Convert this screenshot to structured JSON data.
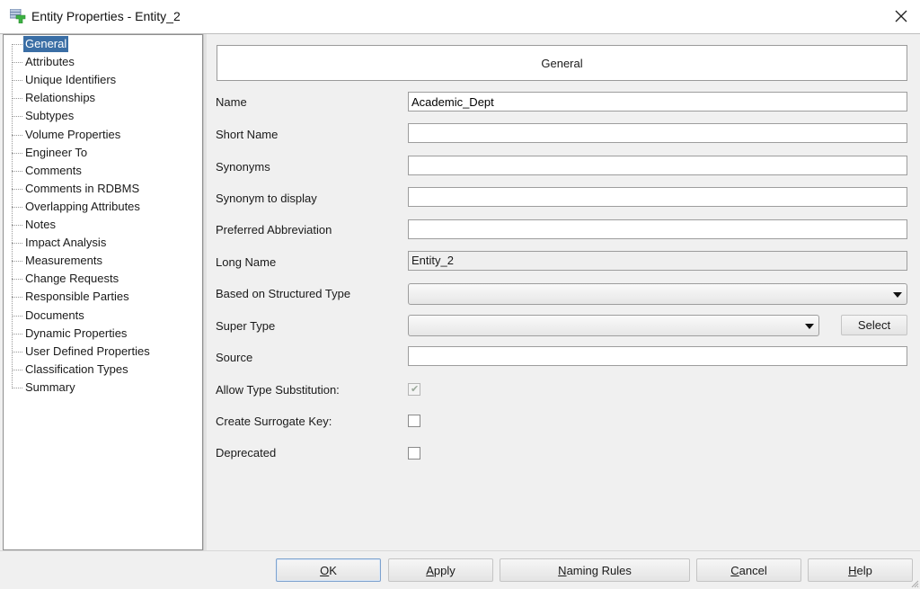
{
  "window": {
    "title": "Entity Properties - Entity_2",
    "app_icon": "entity-table-icon",
    "close_icon": "close-icon"
  },
  "tree": {
    "selected": "General",
    "items": [
      {
        "label": "General"
      },
      {
        "label": "Attributes"
      },
      {
        "label": "Unique Identifiers"
      },
      {
        "label": "Relationships"
      },
      {
        "label": "Subtypes"
      },
      {
        "label": "Volume Properties"
      },
      {
        "label": "Engineer To"
      },
      {
        "label": "Comments"
      },
      {
        "label": "Comments in RDBMS"
      },
      {
        "label": "Overlapping Attributes"
      },
      {
        "label": "Notes"
      },
      {
        "label": "Impact Analysis"
      },
      {
        "label": "Measurements"
      },
      {
        "label": "Change Requests"
      },
      {
        "label": "Responsible Parties"
      },
      {
        "label": "Documents"
      },
      {
        "label": "Dynamic Properties"
      },
      {
        "label": "User Defined Properties"
      },
      {
        "label": "Classification Types"
      },
      {
        "label": "Summary"
      }
    ]
  },
  "panel": {
    "header": "General",
    "fields": {
      "name": {
        "label": "Name",
        "value": "Academic_Dept"
      },
      "short_name": {
        "label": "Short Name",
        "value": ""
      },
      "synonyms": {
        "label": "Synonyms",
        "value": ""
      },
      "synonym_display": {
        "label": "Synonym to display",
        "value": ""
      },
      "preferred_abbreviation": {
        "label": "Preferred Abbreviation",
        "value": ""
      },
      "long_name": {
        "label": "Long Name",
        "value": "Entity_2"
      },
      "based_on_structured_type": {
        "label": "Based on Structured Type",
        "value": ""
      },
      "super_type": {
        "label": "Super Type",
        "value": "",
        "select_label": "Select"
      },
      "source": {
        "label": "Source",
        "value": ""
      },
      "allow_type_substitution": {
        "label": "Allow Type Substitution:",
        "checked": true,
        "disabled": true
      },
      "create_surrogate_key": {
        "label": "Create Surrogate Key:",
        "checked": false
      },
      "deprecated": {
        "label": "Deprecated",
        "checked": false
      }
    }
  },
  "footer": {
    "ok": {
      "mnemonic": "O",
      "rest": "K"
    },
    "apply": {
      "mnemonic": "A",
      "rest": "pply"
    },
    "naming_rules": {
      "mnemonic": "N",
      "rest": "aming Rules"
    },
    "cancel": {
      "mnemonic": "C",
      "rest": "ancel"
    },
    "help": {
      "mnemonic": "H",
      "rest": "elp"
    }
  }
}
